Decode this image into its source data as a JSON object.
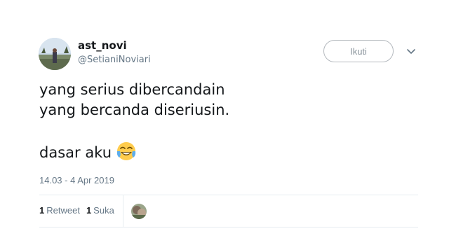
{
  "author": {
    "name": "ast_novi",
    "handle": "@SetianiNoviari",
    "avatar_icon": "profile-photo-outdoor"
  },
  "follow_button": {
    "label": "Ikuti"
  },
  "menu": {
    "icon": "chevron-down-icon"
  },
  "tweet": {
    "lines": [
      "yang serius dibercandain",
      "yang bercanda diseriusin.",
      "",
      "dasar aku"
    ],
    "emoji": "face-with-tears-of-joy"
  },
  "timestamp": "14.03 - 4 Apr 2019",
  "stats": {
    "retweet_count": "1",
    "retweet_label": "Retweet",
    "like_count": "1",
    "like_label": "Suka"
  },
  "colors": {
    "text": "#14171a",
    "secondary": "#657786",
    "border": "#e6ecf0",
    "button_border": "#b4b9be"
  }
}
